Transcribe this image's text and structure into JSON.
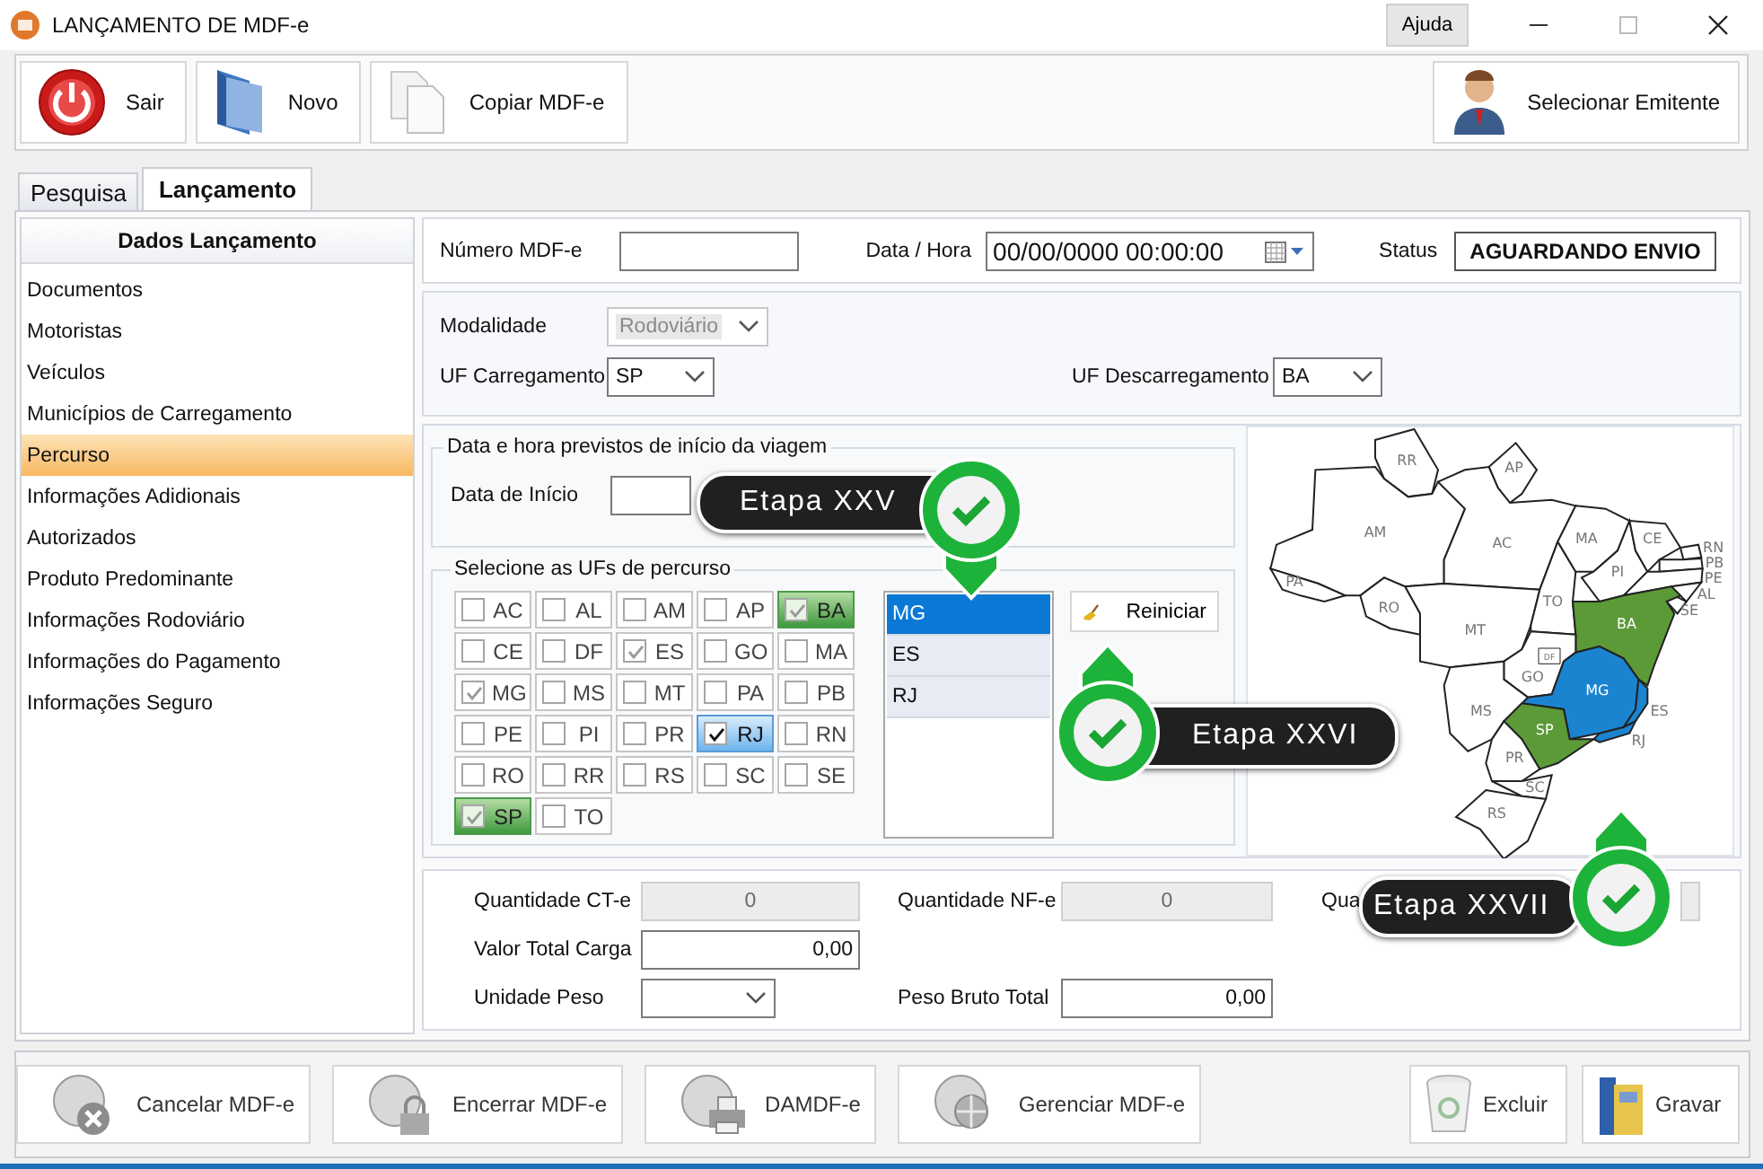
{
  "window": {
    "title": "LANÇAMENTO DE MDF-e",
    "help_button": "Ajuda"
  },
  "toolbar": [
    {
      "label": "Sair"
    },
    {
      "label": "Novo"
    },
    {
      "label": "Copiar MDF-e"
    }
  ],
  "emitter_button": {
    "label": "Selecionar Emitente"
  },
  "tabs": [
    {
      "label": "Pesquisa",
      "selected": false
    },
    {
      "label": "Lançamento",
      "selected": true
    }
  ],
  "sidebar": {
    "title": "Dados Lançamento",
    "items": [
      {
        "label": "Documentos",
        "selected": false
      },
      {
        "label": "Motoristas",
        "selected": false
      },
      {
        "label": "Veículos",
        "selected": false
      },
      {
        "label": "Municípios de Carregamento",
        "selected": false
      },
      {
        "label": "Percurso",
        "selected": true
      },
      {
        "label": "Informações Adidionais",
        "selected": false
      },
      {
        "label": "Autorizados",
        "selected": false
      },
      {
        "label": "Produto Predominante",
        "selected": false
      },
      {
        "label": "Informações Rodoviário",
        "selected": false
      },
      {
        "label": "Informações do Pagamento",
        "selected": false
      },
      {
        "label": "Informações Seguro",
        "selected": false
      }
    ]
  },
  "header": {
    "numero_label": "Número MDF-e",
    "data_hora_label": "Data / Hora",
    "data_hora_value": "00/00/0000 00:00:00",
    "status_label": "Status",
    "status_value": "AGUARDANDO ENVIO"
  },
  "transport": {
    "modalidade_label": "Modalidade",
    "modalidade": {
      "value": "Rodoviário",
      "disabled": true
    },
    "uf_carregamento_label": "UF Carregamento",
    "uf_carregamento": "SP",
    "uf_descarregamento_label": "UF Descarregamento",
    "uf_descarregamento": "BA"
  },
  "viagem": {
    "title": "Data e hora previstos de início da viagem",
    "data_inicio_label": "Data de Início"
  },
  "percurso": {
    "title": "Selecione as UFs de percurso",
    "reset_button": "Reiniciar",
    "ufs": [
      {
        "label": "AC",
        "checked": false,
        "selected": false,
        "endpoint": false
      },
      {
        "label": "AL",
        "checked": false,
        "selected": false,
        "endpoint": false
      },
      {
        "label": "AM",
        "checked": false,
        "selected": false,
        "endpoint": false
      },
      {
        "label": "AP",
        "checked": false,
        "selected": false,
        "endpoint": false
      },
      {
        "label": "BA",
        "checked": true,
        "selected": false,
        "endpoint": true
      },
      {
        "label": "CE",
        "checked": false,
        "selected": false,
        "endpoint": false
      },
      {
        "label": "DF",
        "checked": false,
        "selected": false,
        "endpoint": false
      },
      {
        "label": "ES",
        "checked": true,
        "selected": false,
        "endpoint": false
      },
      {
        "label": "GO",
        "checked": false,
        "selected": false,
        "endpoint": false
      },
      {
        "label": "MA",
        "checked": false,
        "selected": false,
        "endpoint": false
      },
      {
        "label": "MG",
        "checked": true,
        "selected": false,
        "endpoint": false
      },
      {
        "label": "MS",
        "checked": false,
        "selected": false,
        "endpoint": false
      },
      {
        "label": "MT",
        "checked": false,
        "selected": false,
        "endpoint": false
      },
      {
        "label": "PA",
        "checked": false,
        "selected": false,
        "endpoint": false
      },
      {
        "label": "PB",
        "checked": false,
        "selected": false,
        "endpoint": false
      },
      {
        "label": "PE",
        "checked": false,
        "selected": false,
        "endpoint": false
      },
      {
        "label": "PI",
        "checked": false,
        "selected": false,
        "endpoint": false
      },
      {
        "label": "PR",
        "checked": false,
        "selected": false,
        "endpoint": false
      },
      {
        "label": "RJ",
        "checked": true,
        "selected": true,
        "endpoint": false
      },
      {
        "label": "RN",
        "checked": false,
        "selected": false,
        "endpoint": false
      },
      {
        "label": "RO",
        "checked": false,
        "selected": false,
        "endpoint": false
      },
      {
        "label": "RR",
        "checked": false,
        "selected": false,
        "endpoint": false
      },
      {
        "label": "RS",
        "checked": false,
        "selected": false,
        "endpoint": false
      },
      {
        "label": "SC",
        "checked": false,
        "selected": false,
        "endpoint": false
      },
      {
        "label": "SE",
        "checked": false,
        "selected": false,
        "endpoint": false
      },
      {
        "label": "SP",
        "checked": true,
        "selected": false,
        "endpoint": true
      },
      {
        "label": "TO",
        "checked": false,
        "selected": false,
        "endpoint": false
      }
    ],
    "route": [
      {
        "label": "MG",
        "selected": true
      },
      {
        "label": "ES",
        "selected": false
      },
      {
        "label": "RJ",
        "selected": false
      }
    ]
  },
  "map": {
    "states": [
      {
        "uf": "RR",
        "color": "#ffffff"
      },
      {
        "uf": "AP",
        "color": "#ffffff"
      },
      {
        "uf": "AM",
        "color": "#ffffff"
      },
      {
        "uf": "AC",
        "color": "#ffffff"
      },
      {
        "uf": "PA",
        "color": "#ffffff"
      },
      {
        "uf": "RO",
        "color": "#ffffff"
      },
      {
        "uf": "MT",
        "color": "#ffffff"
      },
      {
        "uf": "TO",
        "color": "#ffffff"
      },
      {
        "uf": "MA",
        "color": "#ffffff"
      },
      {
        "uf": "PI",
        "color": "#ffffff"
      },
      {
        "uf": "CE",
        "color": "#ffffff"
      },
      {
        "uf": "RN",
        "color": "#ffffff"
      },
      {
        "uf": "PB",
        "color": "#ffffff"
      },
      {
        "uf": "PE",
        "color": "#ffffff"
      },
      {
        "uf": "AL",
        "color": "#ffffff"
      },
      {
        "uf": "SE",
        "color": "#ffffff"
      },
      {
        "uf": "BA",
        "color": "#5c9a38"
      },
      {
        "uf": "GO",
        "color": "#ffffff"
      },
      {
        "uf": "DF",
        "color": "#ffffff"
      },
      {
        "uf": "MG",
        "color": "#1b84d0"
      },
      {
        "uf": "ES",
        "color": "#1b84d0"
      },
      {
        "uf": "RJ",
        "color": "#1b84d0"
      },
      {
        "uf": "MS",
        "color": "#ffffff"
      },
      {
        "uf": "SP",
        "color": "#5c9a38"
      },
      {
        "uf": "PR",
        "color": "#ffffff"
      },
      {
        "uf": "SC",
        "color": "#ffffff"
      },
      {
        "uf": "RS",
        "color": "#ffffff"
      }
    ]
  },
  "totals": {
    "rows": [
      [
        {
          "kind": "text",
          "label": "Quantidade CT-e",
          "value": "0",
          "disabled": true
        },
        {
          "kind": "text",
          "label": "Quantidade NF-e",
          "value": "0",
          "disabled": true
        },
        {
          "kind": "text",
          "label": "Qua",
          "disabled": true
        }
      ],
      [
        {
          "kind": "text",
          "label": "Valor Total Carga",
          "value": "0,00",
          "disabled": false
        }
      ],
      [
        {
          "kind": "combo",
          "label": "Unidade Peso",
          "disabled": false
        },
        {
          "kind": "text",
          "label": "Peso Bruto Total",
          "value": "0,00",
          "disabled": false
        }
      ]
    ]
  },
  "actions": [
    {
      "label": "Cancelar MDF-e"
    },
    {
      "label": "Encerrar MDF-e"
    },
    {
      "label": "DAMDF-e"
    },
    {
      "label": "Gerenciar MDF-e"
    }
  ],
  "right_actions": [
    {
      "label": "Excluir"
    },
    {
      "label": "Gravar"
    }
  ],
  "callouts": [
    {
      "label": "Etapa XXV"
    },
    {
      "label": "Etapa XXVI"
    },
    {
      "label": "Etapa XXVII"
    }
  ]
}
